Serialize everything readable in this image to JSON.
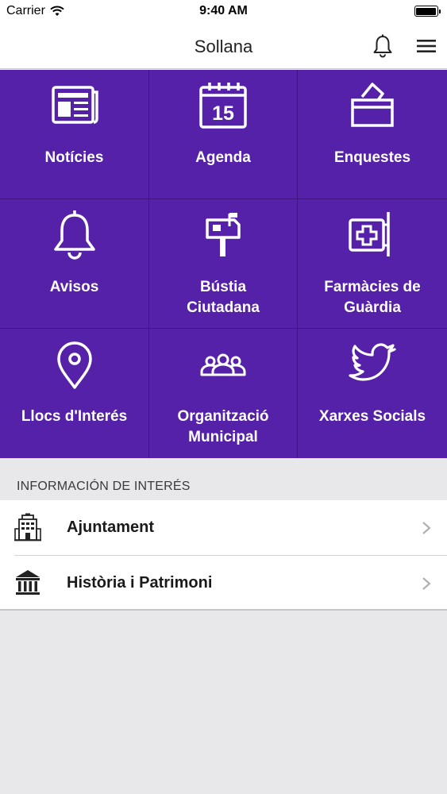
{
  "status_bar": {
    "carrier": "Carrier",
    "time": "9:40 AM",
    "wifi_icon": "wifi-icon",
    "battery_icon": "battery-icon"
  },
  "nav": {
    "title": "Sollana",
    "notifications_icon": "bell-icon",
    "menu_icon": "hamburger-menu-icon"
  },
  "colors": {
    "grid_background": "#5521a8",
    "grid_divider": "#3f1585",
    "page_background": "#e8e7ea"
  },
  "tiles": [
    {
      "label": "Notícies",
      "icon": "newspaper-icon"
    },
    {
      "label": "Agenda",
      "icon": "calendar-icon",
      "icon_text": "15"
    },
    {
      "label": "Enquestes",
      "icon": "ballot-box-icon"
    },
    {
      "label": "Avisos",
      "icon": "bell-icon"
    },
    {
      "label": "Bústia\nCiutadana",
      "icon": "mailbox-icon"
    },
    {
      "label": "Farmàcies de\nGuàrdia",
      "icon": "pharmacy-icon"
    },
    {
      "label": "Llocs d'Interés",
      "icon": "map-pin-icon"
    },
    {
      "label": "Organització\nMunicipal",
      "icon": "people-group-icon"
    },
    {
      "label": "Xarxes Socials",
      "icon": "twitter-icon"
    }
  ],
  "info_section": {
    "header": "INFORMACIÓN DE INTERÉS",
    "items": [
      {
        "label": "Ajuntament",
        "icon": "town-hall-building-icon"
      },
      {
        "label": "Història i Patrimoni",
        "icon": "museum-columns-icon"
      }
    ]
  }
}
